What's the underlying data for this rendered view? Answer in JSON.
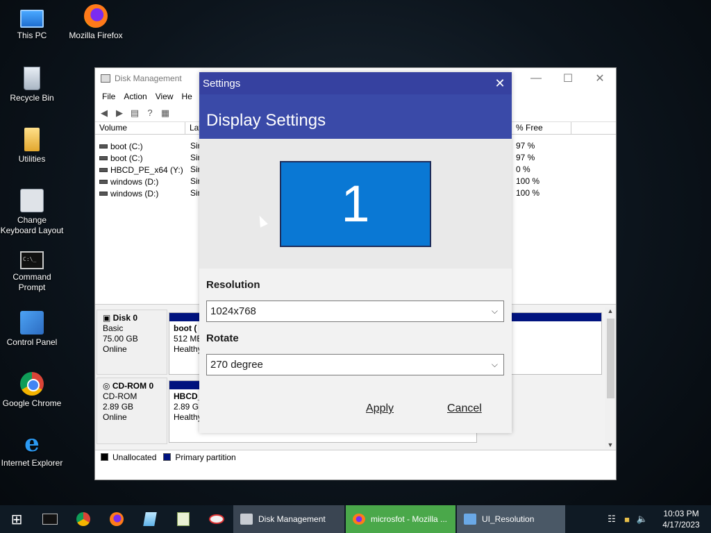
{
  "desktop": {
    "icons": [
      {
        "label": "This PC",
        "icon": "this-pc-icon"
      },
      {
        "label": "Mozilla Firefox",
        "icon": "firefox-icon"
      },
      {
        "label": "Recycle Bin",
        "icon": "recycle-bin-icon"
      },
      {
        "label": "Utilities",
        "icon": "folder-icon"
      },
      {
        "label": "Change Keyboard Layout",
        "icon": "keyboard-icon"
      },
      {
        "label": "Command Prompt",
        "icon": "command-prompt-icon"
      },
      {
        "label": "Control Panel",
        "icon": "control-panel-icon"
      },
      {
        "label": "Google Chrome",
        "icon": "chrome-icon"
      },
      {
        "label": "Internet Explorer",
        "icon": "internet-explorer-icon"
      }
    ]
  },
  "disk_management": {
    "title": "Disk Management",
    "menu": [
      "File",
      "Action",
      "View",
      "He"
    ],
    "columns": {
      "volume": "Volume",
      "layout": "Lay",
      "free_pct": "% Free"
    },
    "volumes": [
      {
        "name": "boot (C:)",
        "layout": "Sir",
        "free": "97 %"
      },
      {
        "name": "boot (C:)",
        "layout": "Sir",
        "free": "97 %"
      },
      {
        "name": "HBCD_PE_x64 (Y:)",
        "layout": "Sir",
        "free": "0 %"
      },
      {
        "name": "windows (D:)",
        "layout": "Sir",
        "free": "100 %"
      },
      {
        "name": "windows (D:)",
        "layout": "Sir",
        "free": "100 %"
      }
    ],
    "disks": [
      {
        "name": "Disk 0",
        "type": "Basic",
        "size": "75.00 GB",
        "status": "Online",
        "partition": {
          "name": "boot  (",
          "size": "512 ME",
          "status": "Healthy"
        }
      },
      {
        "name": "CD-ROM 0",
        "type": "CD-ROM",
        "size": "2.89 GB",
        "status": "Online",
        "partition": {
          "name": "HBCD_",
          "size": "2.89 GE",
          "status": "Healthy"
        }
      }
    ],
    "legend": {
      "unallocated": "Unallocated",
      "primary": "Primary partition"
    },
    "colors": {
      "primary": "#00137f",
      "unallocated": "#000000"
    }
  },
  "settings_dialog": {
    "title": "Settings",
    "header": "Display Settings",
    "monitor_number": "1",
    "resolution_label": "Resolution",
    "resolution_value": "1024x768",
    "rotate_label": "Rotate",
    "rotate_value": "270 degree",
    "apply_label": "Apply",
    "cancel_label": "Cancel",
    "colors": {
      "titlebar": "#3641a0",
      "header": "#3a4aa8",
      "monitor": "#0a78d4"
    }
  },
  "taskbar": {
    "tasks": [
      {
        "label": "Disk Management",
        "active": false
      },
      {
        "label": "microsfot - Mozilla ...",
        "active": true
      },
      {
        "label": "UI_Resolution",
        "active": false
      }
    ],
    "clock_time": "10:03 PM",
    "clock_date": "4/17/2023"
  }
}
